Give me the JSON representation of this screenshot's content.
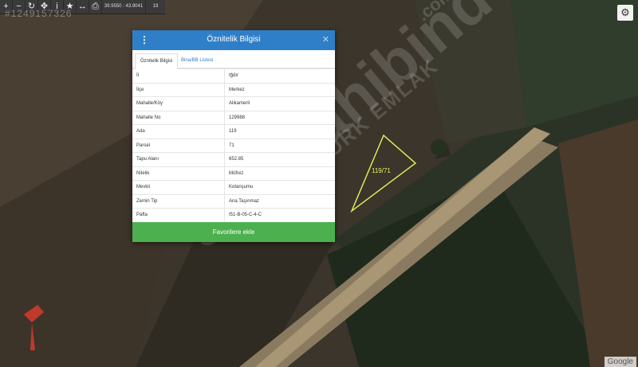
{
  "toolbar": {
    "coord": "39.9550 : 43.9041",
    "zoom": "19"
  },
  "map": {
    "id_text": "#1249157326",
    "parcel_label": "119/71",
    "google": "Google",
    "watermark_main": "satilsahibinden",
    "watermark_sub": "AKTÜRK EMLAK",
    "watermark_com": ".com"
  },
  "modal": {
    "title": "Öznitelik Bilgisi",
    "tabs": [
      "Öznitelik Bilgisi",
      "Bina/BB Listesi"
    ],
    "rows": [
      {
        "key": "İl",
        "value": "Iğdır"
      },
      {
        "key": "İlçe",
        "value": "Merkez"
      },
      {
        "key": "Mahalle/Köy",
        "value": "Alikamerli"
      },
      {
        "key": "Mahalle No",
        "value": "129988"
      },
      {
        "key": "Ada",
        "value": "119"
      },
      {
        "key": "Parsel",
        "value": "71"
      },
      {
        "key": "Tapu Alanı",
        "value": "652.85"
      },
      {
        "key": "Nitelik",
        "value": "Müfrez"
      },
      {
        "key": "Mevkii",
        "value": "Kotanşumu"
      },
      {
        "key": "Zemin Tip",
        "value": "Ana Taşınmaz"
      },
      {
        "key": "Pafta",
        "value": "I51-B-05-C-4-C"
      }
    ],
    "button": "Favorilere ekle"
  },
  "colors": {
    "header": "#2f7fc8",
    "button": "#4db04f"
  }
}
